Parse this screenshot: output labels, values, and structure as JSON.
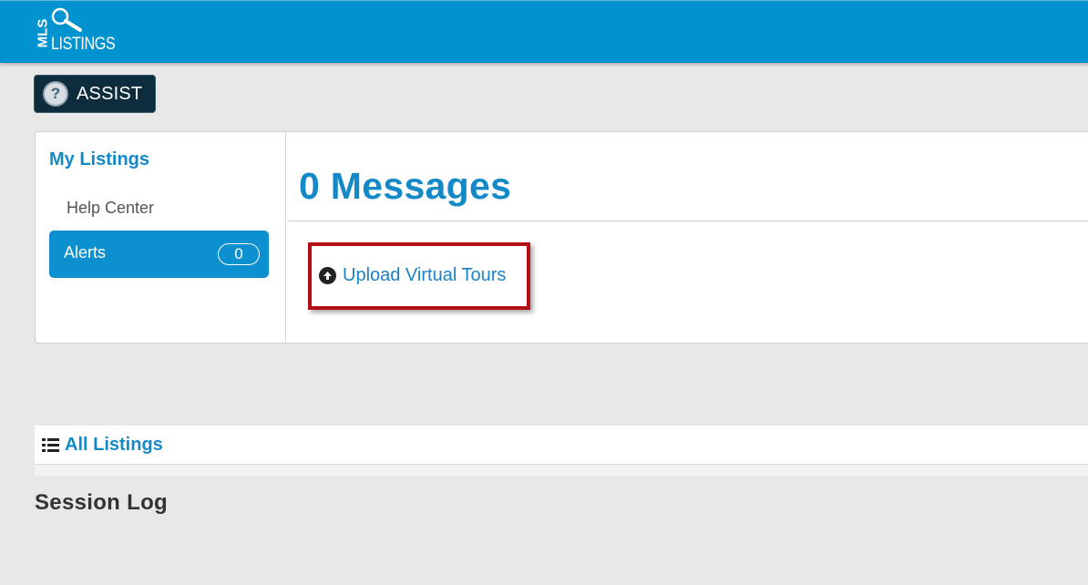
{
  "header": {
    "logo_top": "MLS",
    "logo_bottom": "LISTINGS",
    "background_color": "#0093d0"
  },
  "assist": {
    "icon": "question-circle-icon",
    "icon_glyph": "?",
    "label": "ASSIST"
  },
  "sidebar": {
    "title": "My Listings",
    "items": [
      {
        "label": "Help Center"
      },
      {
        "label": "Alerts",
        "count": "0"
      }
    ]
  },
  "main": {
    "messages_title": "0 Messages",
    "upload_link": {
      "icon": "upload-circle-icon",
      "label": "Upload Virtual Tours"
    },
    "highlight_color": "#b30f16"
  },
  "all_listings": {
    "icon": "list-icon",
    "label": "All Listings"
  },
  "session_log": {
    "title": "Session Log"
  }
}
